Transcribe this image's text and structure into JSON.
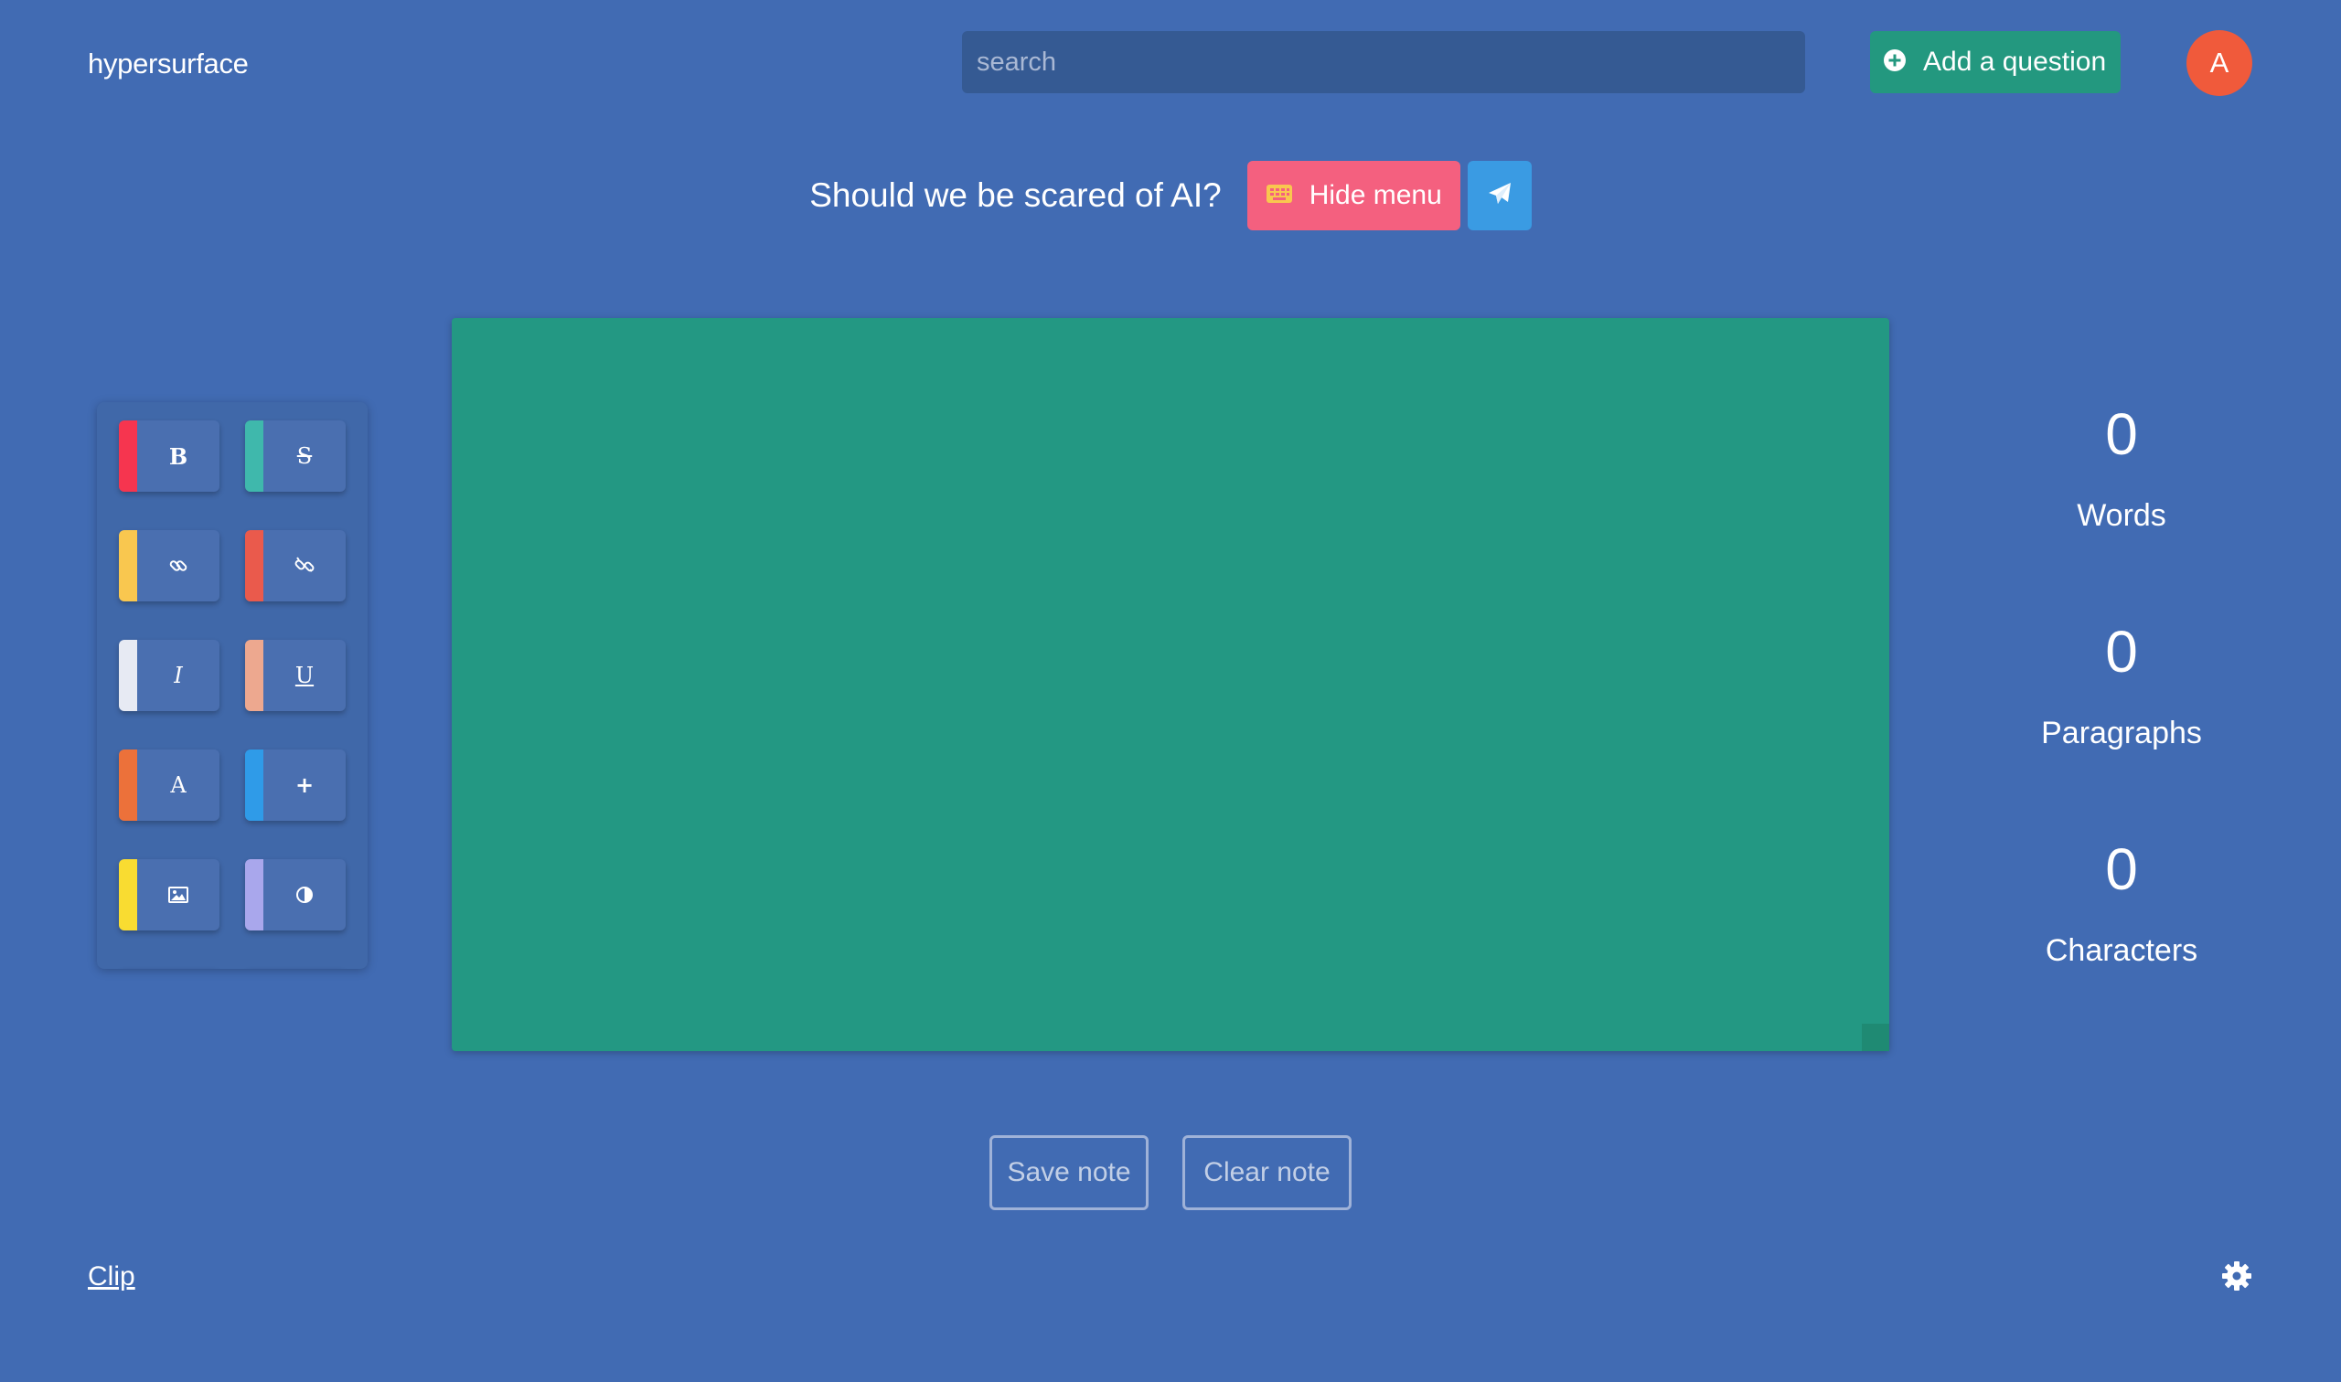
{
  "header": {
    "brand": "hypersurface",
    "search_placeholder": "search",
    "add_question_label": "Add a question",
    "avatar_initial": "A"
  },
  "question": {
    "title": "Should we be scared of AI?",
    "hide_menu_label": "Hide menu"
  },
  "toolbar": {
    "buttons": [
      {
        "name": "bold",
        "glyph": "B",
        "stripe_color": "#f6354f"
      },
      {
        "name": "strikethrough",
        "glyph": "S",
        "stripe_color": "#3fb8ac"
      },
      {
        "name": "link",
        "glyph": "link-icon",
        "stripe_color": "#f9c74f"
      },
      {
        "name": "unlink",
        "glyph": "unlink-icon",
        "stripe_color": "#ea5a4c"
      },
      {
        "name": "italic",
        "glyph": "I",
        "stripe_color": "#e7eaf3"
      },
      {
        "name": "underline",
        "glyph": "U",
        "stripe_color": "#eda88f"
      },
      {
        "name": "font-color",
        "glyph": "A",
        "stripe_color": "#ec713a"
      },
      {
        "name": "add",
        "glyph": "+",
        "stripe_color": "#2f9be8"
      },
      {
        "name": "image",
        "glyph": "image-icon",
        "stripe_color": "#f9dc31"
      },
      {
        "name": "contrast",
        "glyph": "contrast-icon",
        "stripe_color": "#a9a7ec"
      }
    ]
  },
  "editor": {
    "content": ""
  },
  "stats": {
    "words": {
      "value": "0",
      "label": "Words"
    },
    "paragraphs": {
      "value": "0",
      "label": "Paragraphs"
    },
    "characters": {
      "value": "0",
      "label": "Characters"
    }
  },
  "actions": {
    "save_label": "Save note",
    "clear_label": "Clear note"
  },
  "footer": {
    "clip_label": "Clip"
  },
  "colors": {
    "background": "#416bb3",
    "editor": "#239883",
    "add_button": "#23987f",
    "hide_menu_button": "#f4607f",
    "send_button": "#3a9be3",
    "avatar": "#f05a3b"
  }
}
